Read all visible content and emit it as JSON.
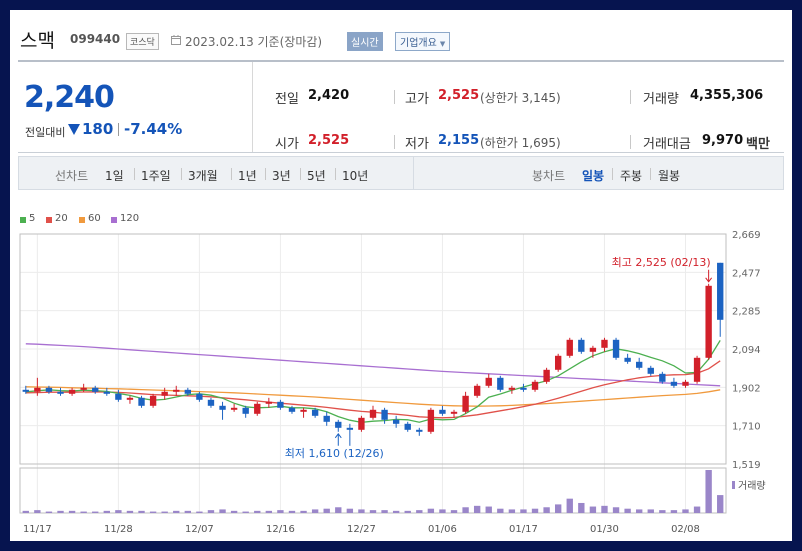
{
  "header": {
    "stock_name": "스맥",
    "stock_code": "099440",
    "market": "코스닥",
    "as_of": "2023.02.13 기준(장마감)",
    "realtime_label": "실시간",
    "overview_label": "기업개요"
  },
  "quote": {
    "price": "2,240",
    "prev_label": "전일대비",
    "change": "180",
    "change_pct": "-7.44%",
    "prev_close_label": "전일",
    "prev_close": "2,420",
    "high_label": "고가",
    "high": "2,525",
    "upper_limit": "(상한가 3,145)",
    "volume_label": "거래량",
    "volume": "4,355,306",
    "open_label": "시가",
    "open": "2,525",
    "low_label": "저가",
    "low": "2,155",
    "lower_limit": "(하한가 1,695)",
    "amount_label": "거래대금",
    "amount": "9,970",
    "amount_unit": "백만"
  },
  "period_bar": {
    "line_label": "선차트",
    "line_tabs": [
      "1일",
      "1주일",
      "3개월",
      "1년",
      "3년",
      "5년",
      "10년"
    ],
    "candle_label": "봉차트",
    "candle_tabs": [
      "일봉",
      "주봉",
      "월봉"
    ],
    "active_candle": "일봉"
  },
  "colors": {
    "up": "#d2202a",
    "down": "#1c63c2",
    "ma5": "#4cb050",
    "ma20": "#e0514a",
    "ma60": "#f09a3e",
    "ma120": "#a86fd1",
    "volume": "#9a86c9"
  },
  "chart_data": {
    "type": "candlestick",
    "legend": [
      {
        "name": "5",
        "color": "#4cb050"
      },
      {
        "name": "20",
        "color": "#e0514a"
      },
      {
        "name": "60",
        "color": "#f09a3e"
      },
      {
        "name": "120",
        "color": "#a86fd1"
      }
    ],
    "y_ticks": [
      "2,669",
      "2,477",
      "2,285",
      "2,094",
      "1,902",
      "1,710",
      "1,519"
    ],
    "ylim": [
      1519,
      2669
    ],
    "x_ticks": [
      {
        "label": "11/17",
        "index": 1
      },
      {
        "label": "11/28",
        "index": 8
      },
      {
        "label": "12/07",
        "index": 15
      },
      {
        "label": "12/16",
        "index": 22
      },
      {
        "label": "12/27",
        "index": 29
      },
      {
        "label": "01/06",
        "index": 36
      },
      {
        "label": "01/17",
        "index": 43
      },
      {
        "label": "01/30",
        "index": 50
      },
      {
        "label": "02/08",
        "index": 57
      }
    ],
    "volume_label": "거래량",
    "high_annotation": "최고 2,525 (02/13)",
    "low_annotation": "최저 1,610 (12/26)",
    "high_index": 59,
    "low_index": 27,
    "ohlc": [
      [
        1890,
        1910,
        1870,
        1880
      ],
      [
        1880,
        1950,
        1860,
        1900
      ],
      [
        1900,
        1910,
        1870,
        1880
      ],
      [
        1880,
        1900,
        1860,
        1870
      ],
      [
        1870,
        1900,
        1860,
        1890
      ],
      [
        1890,
        1920,
        1880,
        1900
      ],
      [
        1900,
        1910,
        1870,
        1880
      ],
      [
        1880,
        1900,
        1860,
        1870
      ],
      [
        1870,
        1890,
        1830,
        1840
      ],
      [
        1840,
        1860,
        1820,
        1850
      ],
      [
        1850,
        1860,
        1800,
        1810
      ],
      [
        1810,
        1870,
        1800,
        1860
      ],
      [
        1860,
        1900,
        1840,
        1880
      ],
      [
        1880,
        1910,
        1860,
        1890
      ],
      [
        1890,
        1900,
        1860,
        1870
      ],
      [
        1870,
        1880,
        1830,
        1840
      ],
      [
        1840,
        1850,
        1800,
        1810
      ],
      [
        1810,
        1830,
        1740,
        1790
      ],
      [
        1790,
        1820,
        1780,
        1800
      ],
      [
        1800,
        1810,
        1750,
        1770
      ],
      [
        1770,
        1830,
        1760,
        1820
      ],
      [
        1820,
        1850,
        1800,
        1830
      ],
      [
        1830,
        1840,
        1790,
        1800
      ],
      [
        1800,
        1810,
        1770,
        1780
      ],
      [
        1780,
        1800,
        1750,
        1790
      ],
      [
        1790,
        1800,
        1750,
        1760
      ],
      [
        1760,
        1780,
        1710,
        1730
      ],
      [
        1730,
        1740,
        1680,
        1700
      ],
      [
        1700,
        1720,
        1610,
        1690
      ],
      [
        1690,
        1760,
        1680,
        1750
      ],
      [
        1750,
        1810,
        1740,
        1790
      ],
      [
        1790,
        1800,
        1720,
        1740
      ],
      [
        1740,
        1760,
        1700,
        1720
      ],
      [
        1720,
        1730,
        1680,
        1690
      ],
      [
        1690,
        1700,
        1660,
        1680
      ],
      [
        1680,
        1800,
        1670,
        1790
      ],
      [
        1790,
        1810,
        1760,
        1770
      ],
      [
        1770,
        1790,
        1750,
        1780
      ],
      [
        1780,
        1880,
        1770,
        1860
      ],
      [
        1860,
        1920,
        1850,
        1910
      ],
      [
        1910,
        1970,
        1900,
        1950
      ],
      [
        1950,
        1960,
        1880,
        1890
      ],
      [
        1890,
        1910,
        1870,
        1900
      ],
      [
        1900,
        1920,
        1880,
        1890
      ],
      [
        1890,
        1940,
        1880,
        1930
      ],
      [
        1930,
        2000,
        1920,
        1990
      ],
      [
        1990,
        2070,
        1980,
        2060
      ],
      [
        2060,
        2150,
        2050,
        2140
      ],
      [
        2140,
        2150,
        2070,
        2080
      ],
      [
        2080,
        2110,
        2050,
        2100
      ],
      [
        2100,
        2150,
        2080,
        2140
      ],
      [
        2140,
        2150,
        2040,
        2050
      ],
      [
        2050,
        2070,
        2020,
        2030
      ],
      [
        2030,
        2050,
        1990,
        2000
      ],
      [
        2000,
        2010,
        1960,
        1970
      ],
      [
        1970,
        1980,
        1920,
        1930
      ],
      [
        1930,
        1950,
        1900,
        1910
      ],
      [
        1910,
        1940,
        1900,
        1930
      ],
      [
        1930,
        2060,
        1920,
        2050
      ],
      [
        2050,
        2420,
        2040,
        2410
      ],
      [
        2525,
        2525,
        2155,
        2240
      ]
    ],
    "ma5": [
      1880,
      1885,
      1890,
      1886,
      1884,
      1888,
      1886,
      1882,
      1872,
      1862,
      1847,
      1838,
      1842,
      1854,
      1866,
      1870,
      1863,
      1848,
      1823,
      1805,
      1800,
      1802,
      1808,
      1800,
      1800,
      1795,
      1780,
      1756,
      1738,
      1727,
      1733,
      1736,
      1742,
      1740,
      1728,
      1744,
      1740,
      1742,
      1771,
      1805,
      1853,
      1869,
      1888,
      1904,
      1920,
      1935,
      1960,
      1995,
      2030,
      2060,
      2080,
      2095,
      2085,
      2071,
      2052,
      2035,
      2010,
      1974,
      1977,
      2043,
      2137
    ],
    "ma20": [
      1875,
      1876,
      1878,
      1878,
      1878,
      1879,
      1880,
      1879,
      1877,
      1874,
      1870,
      1866,
      1864,
      1862,
      1860,
      1858,
      1855,
      1850,
      1845,
      1840,
      1834,
      1828,
      1823,
      1818,
      1813,
      1808,
      1802,
      1795,
      1788,
      1782,
      1778,
      1772,
      1768,
      1762,
      1755,
      1752,
      1750,
      1752,
      1758,
      1765,
      1775,
      1785,
      1795,
      1806,
      1818,
      1832,
      1848,
      1865,
      1883,
      1900,
      1915,
      1928,
      1940,
      1950,
      1957,
      1962,
      1965,
      1966,
      1973,
      1995,
      2035
    ],
    "ma60": [
      1905,
      1904,
      1903,
      1902,
      1900,
      1899,
      1898,
      1896,
      1895,
      1893,
      1891,
      1889,
      1887,
      1885,
      1883,
      1881,
      1879,
      1877,
      1875,
      1872,
      1869,
      1866,
      1863,
      1860,
      1857,
      1854,
      1850,
      1846,
      1842,
      1838,
      1834,
      1830,
      1826,
      1822,
      1818,
      1815,
      1812,
      1810,
      1809,
      1808,
      1809,
      1810,
      1812,
      1815,
      1818,
      1821,
      1825,
      1829,
      1833,
      1837,
      1841,
      1845,
      1849,
      1853,
      1857,
      1861,
      1864,
      1867,
      1872,
      1880,
      1890
    ],
    "ma120": [
      2120,
      2118,
      2115,
      2112,
      2109,
      2106,
      2102,
      2098,
      2094,
      2090,
      2086,
      2082,
      2078,
      2074,
      2070,
      2066,
      2062,
      2058,
      2054,
      2050,
      2046,
      2042,
      2038,
      2034,
      2030,
      2026,
      2022,
      2018,
      2014,
      2010,
      2006,
      2002,
      1998,
      1994,
      1990,
      1986,
      1982,
      1979,
      1976,
      1973,
      1970,
      1967,
      1964,
      1961,
      1958,
      1955,
      1952,
      1949,
      1946,
      1943,
      1940,
      1937,
      1934,
      1931,
      1928,
      1925,
      1922,
      1919,
      1916,
      1913,
      1910
    ],
    "volume": [
      3,
      4,
      2,
      3,
      3,
      2,
      2,
      3,
      4,
      3,
      3,
      2,
      2,
      3,
      3,
      2,
      4,
      5,
      3,
      2,
      3,
      3,
      4,
      3,
      3,
      5,
      6,
      8,
      6,
      5,
      4,
      4,
      3,
      3,
      4,
      6,
      5,
      4,
      8,
      10,
      9,
      6,
      5,
      5,
      6,
      8,
      12,
      20,
      14,
      9,
      10,
      8,
      6,
      5,
      5,
      4,
      4,
      5,
      9,
      60,
      25
    ]
  }
}
